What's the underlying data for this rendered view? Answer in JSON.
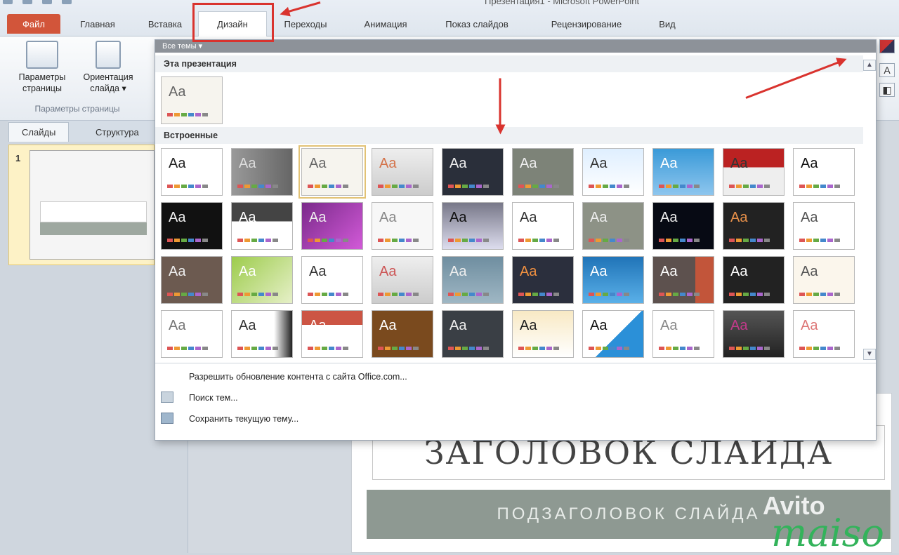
{
  "window": {
    "title": "Презентация1 - Microsoft PowerPoint"
  },
  "ribbon_tabs": [
    {
      "label": "Файл"
    },
    {
      "label": "Главная"
    },
    {
      "label": "Вставка"
    },
    {
      "label": "Дизайн"
    },
    {
      "label": "Переходы"
    },
    {
      "label": "Анимация"
    },
    {
      "label": "Показ слайдов"
    },
    {
      "label": "Рецензирование"
    },
    {
      "label": "Вид"
    }
  ],
  "ribbon": {
    "page_setup_label": "Параметры страницы",
    "orientation_label": "Ориентация слайда",
    "group_label": "Параметры страницы"
  },
  "pane_tabs": [
    {
      "label": "Слайды"
    },
    {
      "label": "Структура"
    }
  ],
  "slide_thumb": {
    "number": "1"
  },
  "gallery": {
    "header": "Все темы",
    "section_this": "Эта презентация",
    "section_builtin": "Встроенные",
    "menu": [
      {
        "label": "Разрешить обновление контента с сайта Office.com..."
      },
      {
        "label": "Поиск тем..."
      },
      {
        "label": "Сохранить текущую тему..."
      }
    ],
    "tile_text": "Aa"
  },
  "slide": {
    "title": "ЗАГОЛОВОК СЛАЙДА",
    "subtitle": "ПОДЗАГОЛОВОК СЛАЙДА"
  },
  "watermark": {
    "brand": "Avito",
    "brand2": "maiso"
  },
  "colors": {
    "accent": "#d9332e",
    "file_tab": "#d2553a",
    "selection": "#e2c275"
  }
}
